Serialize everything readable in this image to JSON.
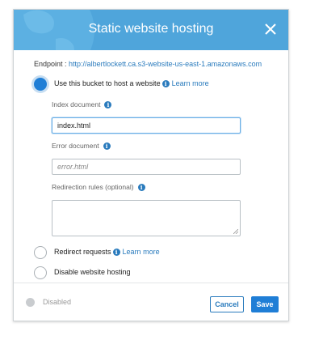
{
  "dialog": {
    "title": "Static website hosting",
    "endpoint_label": "Endpoint :",
    "endpoint_url": "http://albertlockett.ca.s3-website-us-east-1.amazonaws.com"
  },
  "options": {
    "use_bucket": {
      "label": "Use this bucket to host a website",
      "learn_more": "Learn more",
      "selected": true
    },
    "redirect": {
      "label": "Redirect requests",
      "learn_more": "Learn more",
      "selected": false
    },
    "disable": {
      "label": "Disable website hosting",
      "selected": false
    }
  },
  "fields": {
    "index_document": {
      "label": "Index document",
      "value": "index.html"
    },
    "error_document": {
      "label": "Error document",
      "placeholder": "error.html"
    },
    "redirection_rules": {
      "label": "Redirection rules (optional)",
      "value": ""
    }
  },
  "footer": {
    "status_label": "Disabled",
    "cancel_label": "Cancel",
    "save_label": "Save"
  },
  "colors": {
    "header": "#4fa5db",
    "accent": "#1f7ed6",
    "link": "#2a7bbd"
  },
  "icons": {
    "close": "close-icon",
    "info": "info-icon",
    "globe": "globe-icon"
  }
}
